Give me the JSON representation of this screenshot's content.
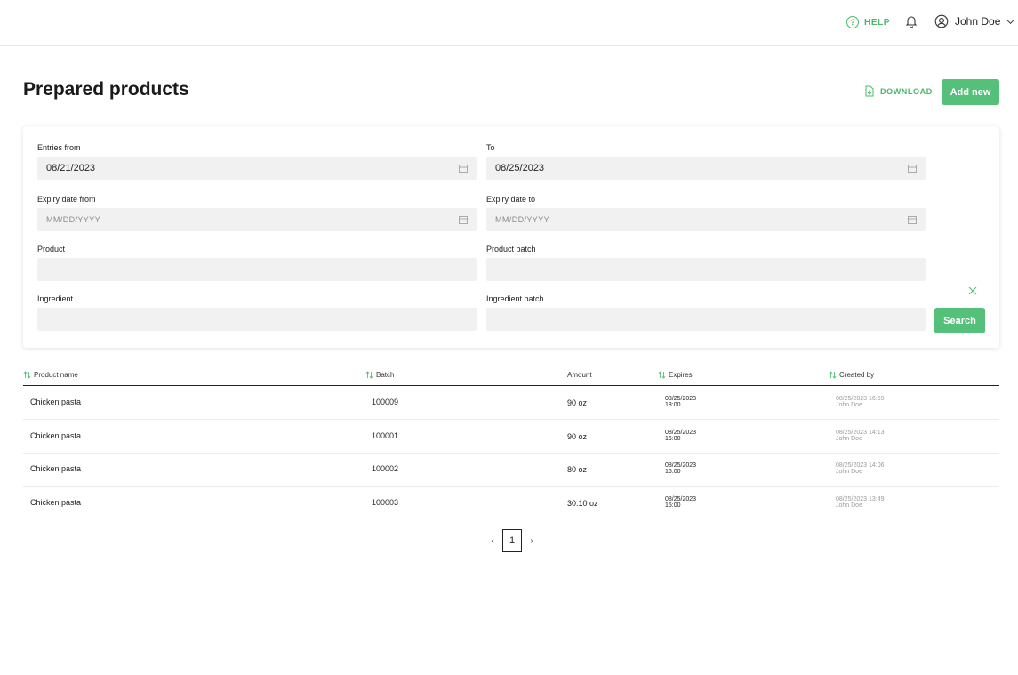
{
  "header": {
    "help_label": "HELP",
    "user_name": "John Doe"
  },
  "page": {
    "title": "Prepared products",
    "download_label": "DOWNLOAD",
    "add_new_label": "Add new"
  },
  "filters": {
    "entries_from": {
      "label": "Entries from",
      "value": "08/21/2023"
    },
    "to": {
      "label": "To",
      "value": "08/25/2023"
    },
    "expiry_from": {
      "label": "Expiry date from",
      "placeholder": "MM/DD/YYYY"
    },
    "expiry_to": {
      "label": "Expiry date to",
      "placeholder": "MM/DD/YYYY"
    },
    "product": {
      "label": "Product",
      "value": ""
    },
    "product_batch": {
      "label": "Product batch",
      "value": ""
    },
    "ingredient": {
      "label": "Ingredient",
      "value": ""
    },
    "ingredient_batch": {
      "label": "Ingredient batch",
      "value": ""
    },
    "search_label": "Search"
  },
  "table": {
    "columns": [
      "Product name",
      "Batch",
      "Amount",
      "Expires",
      "Created by"
    ],
    "rows": [
      {
        "product": "Chicken pasta",
        "batch": "100009",
        "amount": "90 oz",
        "expires_date": "08/25/2023",
        "expires_time": "18:00",
        "created_at": "08/25/2023 16:59",
        "created_by": "John Doe"
      },
      {
        "product": "Chicken pasta",
        "batch": "100001",
        "amount": "90 oz",
        "expires_date": "08/25/2023",
        "expires_time": "16:00",
        "created_at": "08/25/2023 14:13",
        "created_by": "John Doe"
      },
      {
        "product": "Chicken pasta",
        "batch": "100002",
        "amount": "80 oz",
        "expires_date": "08/25/2023",
        "expires_time": "16:00",
        "created_at": "08/25/2023 14:06",
        "created_by": "John Doe"
      },
      {
        "product": "Chicken pasta",
        "batch": "100003",
        "amount": "30.10 oz",
        "expires_date": "08/25/2023",
        "expires_time": "15:00",
        "created_at": "08/25/2023 13:49",
        "created_by": "John Doe"
      }
    ]
  },
  "pagination": {
    "current_page": "1",
    "prev_symbol": "‹",
    "next_symbol": "›"
  },
  "colors": {
    "accent": "#55c07a",
    "accent_text": "#4cb86c",
    "input_bg": "#f1f1f1"
  },
  "icons": [
    "help-icon",
    "bell-icon",
    "user-icon",
    "chevron-down-icon",
    "download-icon",
    "calendar-icon",
    "clear-icon",
    "sort-icon"
  ]
}
